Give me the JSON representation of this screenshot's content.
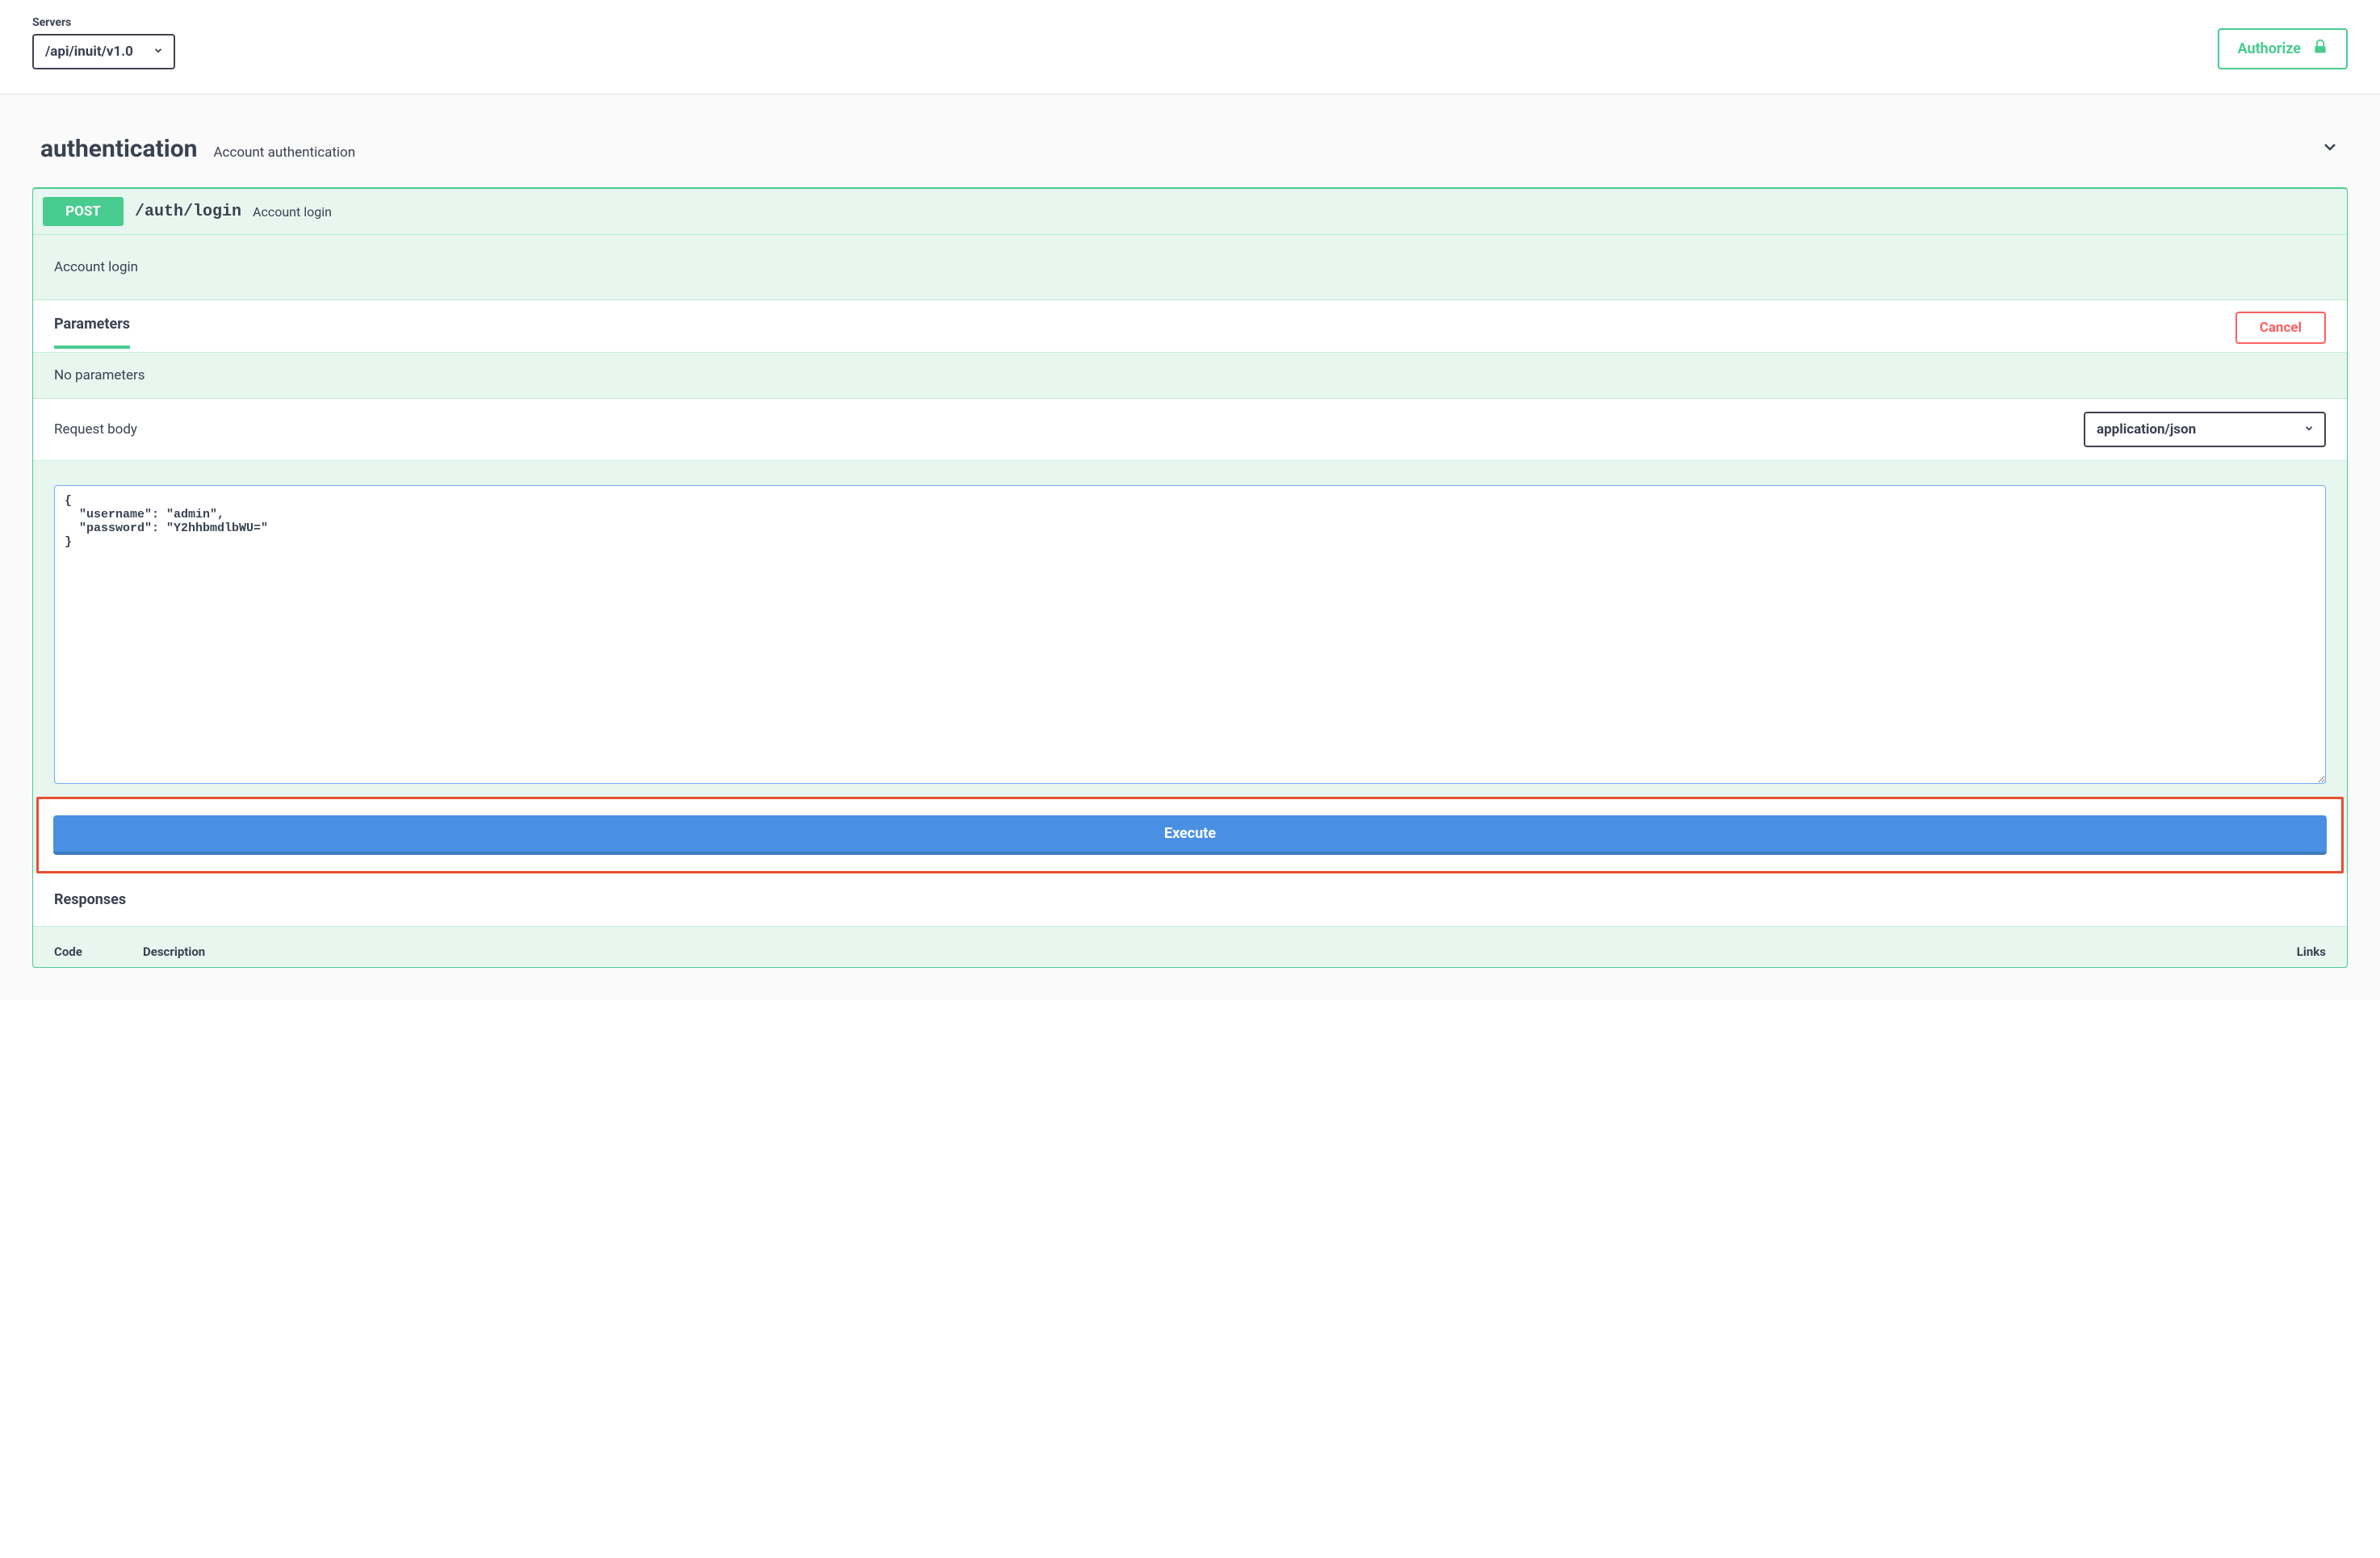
{
  "topbar": {
    "servers_label": "Servers",
    "server_value": "/api/inuit/v1.0",
    "authorize_label": "Authorize"
  },
  "tag": {
    "name": "authentication",
    "description": "Account authentication"
  },
  "operation": {
    "method": "POST",
    "path": "/auth/login",
    "summary": "Account login",
    "description": "Account login",
    "parameters_label": "Parameters",
    "cancel_label": "Cancel",
    "no_parameters_text": "No parameters",
    "request_body_label": "Request body",
    "content_type": "application/json",
    "body_value": "{\n  \"username\": \"admin\",\n  \"password\": \"Y2hhbmdlbWU=\"\n}",
    "execute_label": "Execute",
    "responses_label": "Responses",
    "responses_columns": {
      "code": "Code",
      "description": "Description",
      "links": "Links"
    }
  }
}
